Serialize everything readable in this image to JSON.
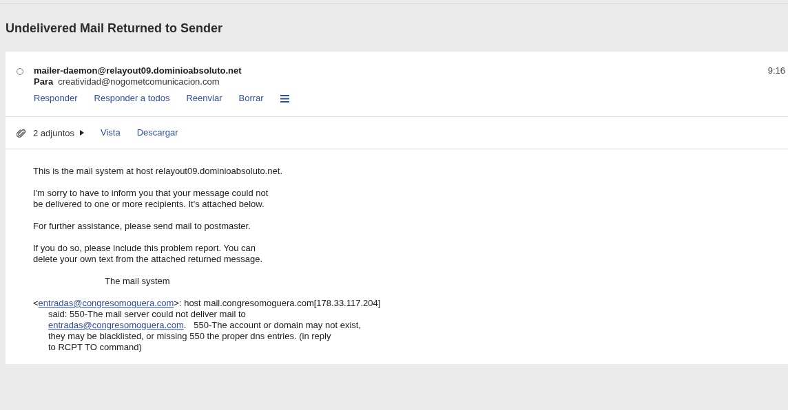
{
  "subject": "Undelivered Mail Returned to Sender",
  "message": {
    "read": false,
    "from": "mailer-daemon@relayout09.dominioabsoluto.net",
    "to_label": "Para",
    "to": "creatividad@nogometcomunicacion.com",
    "time": "9:16",
    "actions": [
      "Responder",
      "Responder a todos",
      "Reenviar",
      "Borrar"
    ]
  },
  "attachments": {
    "count": "2 adjuntos",
    "expanded": false,
    "actions": [
      "Vista",
      "Descargar"
    ]
  },
  "body": [
    {
      "kind": "text",
      "lines": [
        [
          {
            "text": "This is the mail system at host relayout09.dominioabsoluto.net."
          }
        ]
      ]
    },
    {
      "kind": "text",
      "lines": [
        [
          {
            "text": "I'm sorry to have to inform you that your message could not"
          }
        ],
        [
          {
            "text": "be delivered to one or more recipients. It's attached below."
          }
        ]
      ]
    },
    {
      "kind": "text",
      "lines": [
        [
          {
            "text": "For further assistance, please send mail to postmaster."
          }
        ]
      ]
    },
    {
      "kind": "text",
      "lines": [
        [
          {
            "text": "If you do so, please include this problem report. You can"
          }
        ],
        [
          {
            "text": "delete your own text from the attached returned message."
          }
        ]
      ]
    },
    {
      "kind": "signature",
      "lines": [
        [
          {
            "text": "The mail system"
          }
        ]
      ]
    },
    {
      "kind": "report",
      "lines": [
        [
          {
            "text": "<"
          },
          {
            "text": "entradas@congresomoguera.com",
            "link": true
          },
          {
            "text": ">: host mail.congresomoguera.com[178.33.117.204]"
          }
        ],
        [
          {
            "text": "said: 550-The mail server could not deliver mail to"
          }
        ],
        [
          {
            "text": "entradas@congresomoguera.com",
            "link": true
          },
          {
            "text": ".   550-The account or domain may not exist,"
          }
        ],
        [
          {
            "text": "they may be blacklisted, or missing 550 the proper dns entries. (in reply"
          }
        ],
        [
          {
            "text": "to RCPT TO command)"
          }
        ]
      ]
    }
  ]
}
